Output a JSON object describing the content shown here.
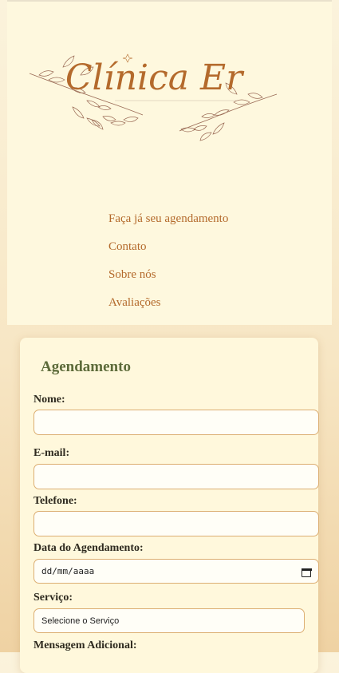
{
  "header": {
    "logo_text": "Clínica Er",
    "brand_color": "#b46a2c",
    "nav": [
      {
        "label": "Faça já seu agendamento"
      },
      {
        "label": "Contato"
      },
      {
        "label": "Sobre nós"
      },
      {
        "label": "Avaliações"
      }
    ]
  },
  "form": {
    "title": "Agendamento",
    "nome_label": "Nome:",
    "nome_value": "",
    "email_label": "E-mail:",
    "email_value": "",
    "telefone_label": "Telefone:",
    "telefone_value": "",
    "data_label": "Data do Agendamento:",
    "data_placeholder": "dd/mm/aaaa",
    "servico_label": "Serviço:",
    "servico_selected": "Selecione o Serviço",
    "mensagem_label": "Mensagem Adicional:"
  },
  "colors": {
    "accent": "#b46a2c",
    "title_green": "#5d6b3a",
    "field_border": "#dcae72"
  }
}
